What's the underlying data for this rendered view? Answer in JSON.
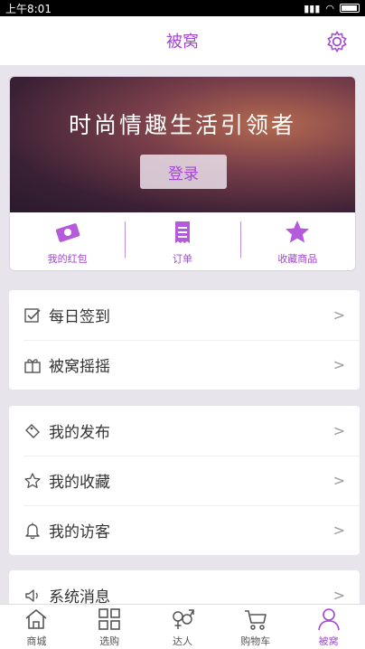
{
  "status": {
    "time": "上午8:01"
  },
  "header": {
    "title": "被窝"
  },
  "hero": {
    "slogan": "时尚情趣生活引领者",
    "login": "登录"
  },
  "quick": [
    {
      "label": "我的红包"
    },
    {
      "label": "订单"
    },
    {
      "label": "收藏商品"
    }
  ],
  "group1": [
    {
      "label": "每日签到"
    },
    {
      "label": "被窝摇摇"
    }
  ],
  "group2": [
    {
      "label": "我的发布"
    },
    {
      "label": "我的收藏"
    },
    {
      "label": "我的访客"
    }
  ],
  "group3": [
    {
      "label": "系统消息"
    }
  ],
  "chevron": ">",
  "tabs": [
    {
      "label": "商城"
    },
    {
      "label": "选购"
    },
    {
      "label": "达人"
    },
    {
      "label": "购物车"
    },
    {
      "label": "被窝"
    }
  ],
  "colors": {
    "accent": "#a545d6"
  }
}
